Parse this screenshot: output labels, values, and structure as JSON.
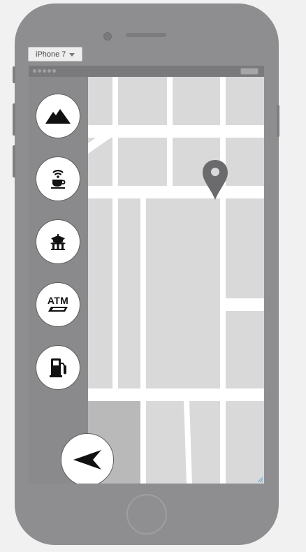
{
  "device": {
    "selector_label": "iPhone 7"
  },
  "sidebar": {
    "buttons": [
      {
        "icon": "mountain-icon"
      },
      {
        "icon": "cafe-wifi-icon"
      },
      {
        "icon": "pagoda-icon"
      },
      {
        "icon": "atm-icon",
        "label": "ATM"
      },
      {
        "icon": "fuel-pump-icon"
      }
    ]
  },
  "map": {
    "marker_icon": "map-pin-icon"
  },
  "locate_button": {
    "icon": "navigation-arrow-icon"
  },
  "colors": {
    "map_block": "#d9d9d9",
    "road": "#ffffff",
    "sidebar": "#8a8a8c",
    "marker": "#6b6b6d"
  }
}
